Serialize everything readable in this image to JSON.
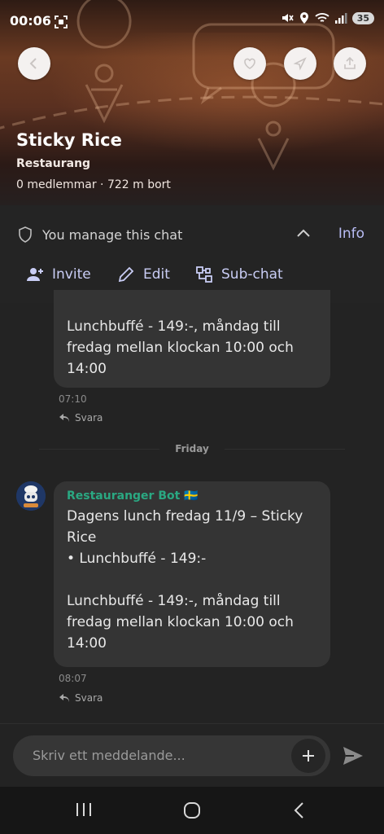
{
  "status_bar": {
    "time": "00:06",
    "battery": "35"
  },
  "header": {
    "title": "Sticky Rice",
    "category": "Restaurang",
    "meta": "0 medlemmar · 722 m bort"
  },
  "manage": {
    "text": "You manage this chat",
    "info_label": "Info",
    "actions": [
      {
        "label": "Invite",
        "icon": "add-person-icon"
      },
      {
        "label": "Edit",
        "icon": "pencil-icon"
      },
      {
        "label": "Sub-chat",
        "icon": "hierarchy-icon"
      }
    ]
  },
  "messages": [
    {
      "text": "Lunchbuffé - 149:-, måndag till fredag mellan klockan 10:00 och 14:00",
      "time": "07:10",
      "reply_label": "Svara"
    },
    {
      "sender": "Restauranger Bot 🇸🇪",
      "text": "Dagens lunch fredag 11/9 – Sticky Rice\n• Lunchbuffé - 149:-\n\nLunchbuffé - 149:-, måndag till fredag mellan klockan 10:00 och 14:00",
      "time": "08:07",
      "reply_label": "Svara"
    }
  ],
  "day_separator": "Friday",
  "composer": {
    "placeholder": "Skriv ett meddelande..."
  },
  "colors": {
    "accent": "#b9bdf5",
    "bot_name": "#2aa882",
    "bubble": "#343434",
    "background": "#232323"
  }
}
